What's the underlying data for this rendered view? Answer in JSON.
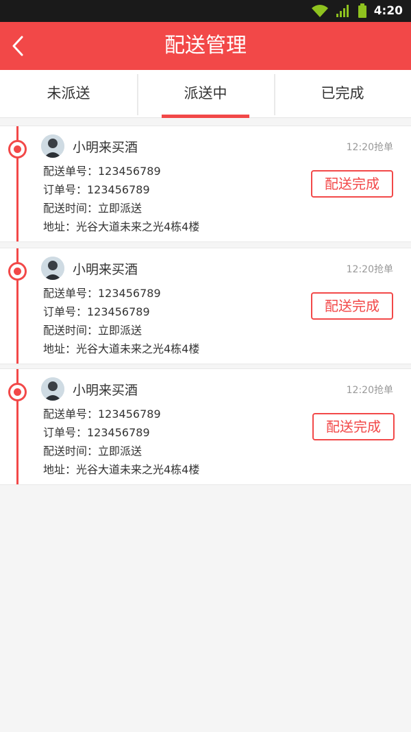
{
  "status_bar": {
    "time": "4:20",
    "icons": [
      "wifi-icon",
      "signal-icon",
      "battery-icon"
    ]
  },
  "header": {
    "title": "配送管理",
    "back_icon": "chevron-left-icon"
  },
  "tabs": [
    {
      "label": "未派送",
      "active": false
    },
    {
      "label": "派送中",
      "active": true
    },
    {
      "label": "已完成",
      "active": false
    }
  ],
  "orders": [
    {
      "name": "小明来买酒",
      "grab_time": "12:20抢单",
      "delivery_no": "配送单号：123456789",
      "order_no": "订单号：123456789",
      "delivery_time": "配送时间：立即派送",
      "address": "地址：光谷大道未来之光4栋4楼",
      "action": "配送完成"
    },
    {
      "name": "小明来买酒",
      "grab_time": "12:20抢单",
      "delivery_no": "配送单号：123456789",
      "order_no": "订单号：123456789",
      "delivery_time": "配送时间：立即派送",
      "address": "地址：光谷大道未来之光4栋4楼",
      "action": "配送完成"
    },
    {
      "name": "小明来买酒",
      "grab_time": "12:20抢单",
      "delivery_no": "配送单号：123456789",
      "order_no": "订单号：123456789",
      "delivery_time": "配送时间：立即派送",
      "address": "地址：光谷大道未来之光4栋4楼",
      "action": "配送完成"
    }
  ],
  "colors": {
    "accent": "#f24848",
    "status_bar": "#1a1a1a",
    "background": "#f5f5f5"
  }
}
